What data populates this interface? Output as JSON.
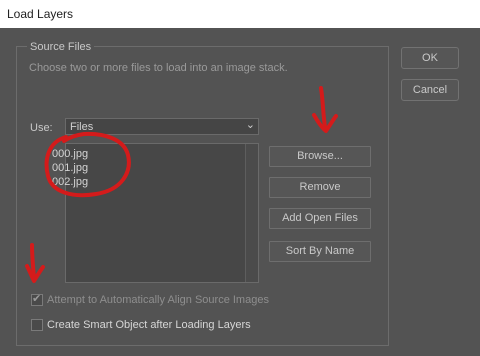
{
  "window": {
    "title": "Load Layers"
  },
  "source_files": {
    "legend": "Source Files",
    "description": "Choose two or more files to load into an image stack.",
    "use_label": "Use:",
    "use_value": "Files",
    "files": [
      "000.jpg",
      "001.jpg",
      "002.jpg"
    ]
  },
  "buttons": {
    "browse": "Browse...",
    "remove": "Remove",
    "add_open_files": "Add Open Files",
    "sort_by_name": "Sort By Name",
    "ok": "OK",
    "cancel": "Cancel"
  },
  "options": {
    "auto_align_label": "Attempt to Automatically Align Source Images",
    "auto_align_checked": true,
    "smart_object_label": "Create Smart Object after Loading Layers",
    "smart_object_checked": false
  },
  "annotation_color": "#d41b1b"
}
